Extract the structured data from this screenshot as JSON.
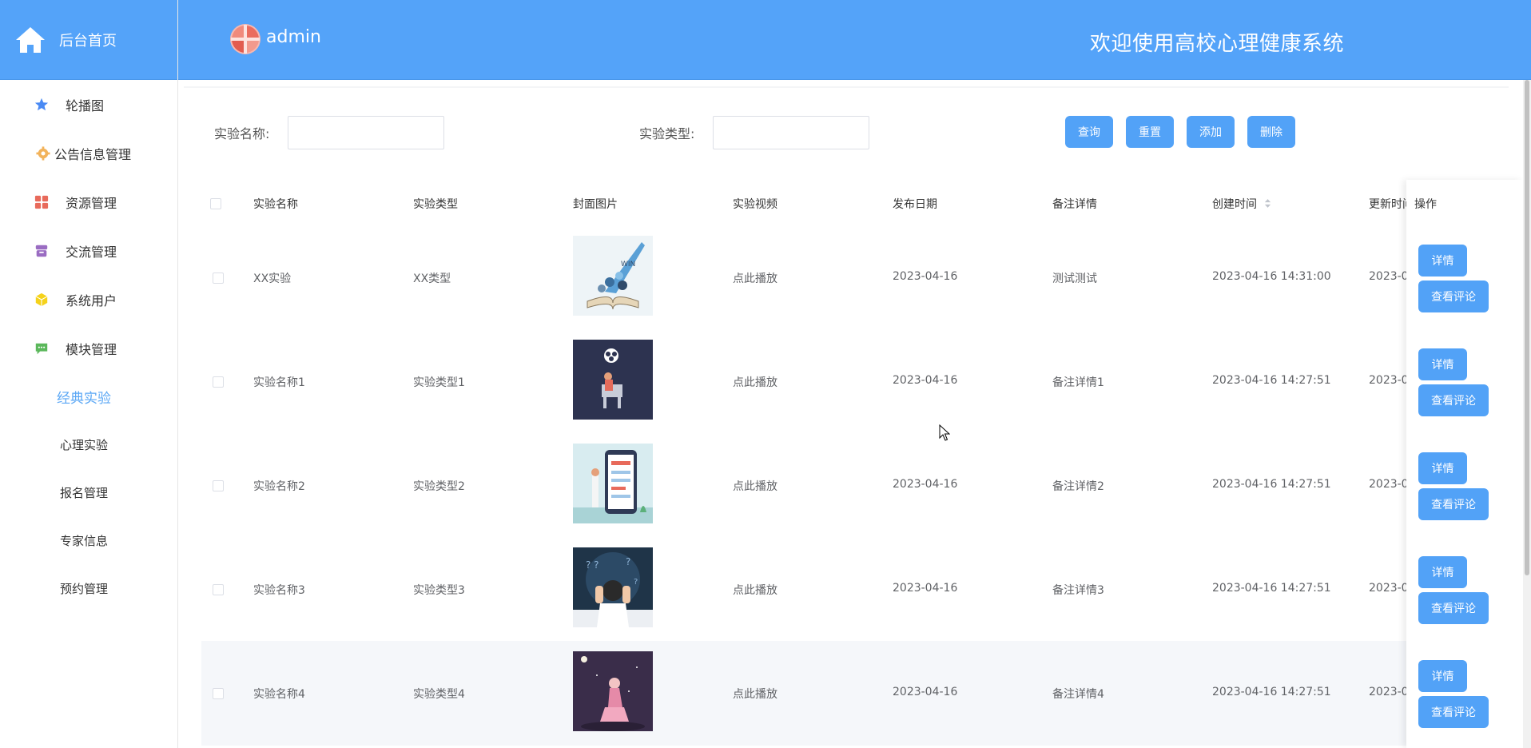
{
  "sidebar": {
    "home_label": "后台首页",
    "items": [
      {
        "label": "轮播图",
        "icon": "star-icon",
        "color": "#4a8af4"
      },
      {
        "label": "公告信息管理",
        "icon": "gear-icon",
        "color": "#f2b35b"
      },
      {
        "label": "资源管理",
        "icon": "grid-icon",
        "color": "#e86a5b"
      },
      {
        "label": "交流管理",
        "icon": "archive-icon",
        "color": "#9a6cc2"
      },
      {
        "label": "系统用户",
        "icon": "cube-icon",
        "color": "#f5d21b"
      },
      {
        "label": "模块管理",
        "icon": "chat-icon",
        "color": "#5bb85b"
      }
    ],
    "sub_items": [
      "经典实验",
      "心理实验",
      "报名管理",
      "专家信息",
      "预约管理"
    ],
    "active_sub": "经典实验"
  },
  "header": {
    "user": "admin",
    "title": "欢迎使用高校心理健康系统"
  },
  "filters": {
    "name_label": "实验名称:",
    "type_label": "实验类型:",
    "name_value": "",
    "type_value": ""
  },
  "actions": {
    "query": "查询",
    "reset": "重置",
    "add": "添加",
    "delete": "删除"
  },
  "table": {
    "columns": [
      "实验名称",
      "实验类型",
      "封面图片",
      "实验视频",
      "发布日期",
      "备注详情",
      "创建时间",
      "更新时间",
      "操作"
    ],
    "rows": [
      {
        "name": "XX实验",
        "type": "XX类型",
        "video": "点此播放",
        "date": "2023-04-16",
        "remark": "测试测试",
        "created": "2023-04-16 14:31:00",
        "updated": "2023-0"
      },
      {
        "name": "实验名称1",
        "type": "实验类型1",
        "video": "点此播放",
        "date": "2023-04-16",
        "remark": "备注详情1",
        "created": "2023-04-16 14:27:51",
        "updated": "2023-0"
      },
      {
        "name": "实验名称2",
        "type": "实验类型2",
        "video": "点此播放",
        "date": "2023-04-16",
        "remark": "备注详情2",
        "created": "2023-04-16 14:27:51",
        "updated": "2023-0"
      },
      {
        "name": "实验名称3",
        "type": "实验类型3",
        "video": "点此播放",
        "date": "2023-04-16",
        "remark": "备注详情3",
        "created": "2023-04-16 14:27:51",
        "updated": "2023-0"
      },
      {
        "name": "实验名称4",
        "type": "实验类型4",
        "video": "点此播放",
        "date": "2023-04-16",
        "remark": "备注详情4",
        "created": "2023-04-16 14:27:51",
        "updated": "2023-0"
      }
    ],
    "op_detail": "详情",
    "op_comments": "查看评论"
  },
  "colors": {
    "primary": "#54a3f9",
    "button": "#52a2f7",
    "active_link": "#5aa7f5"
  }
}
